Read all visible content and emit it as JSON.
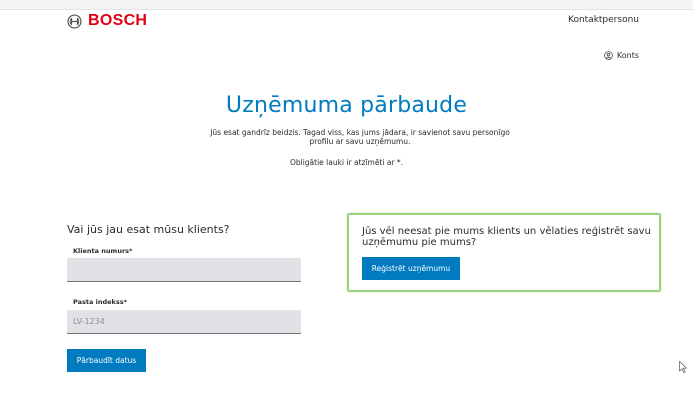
{
  "header": {
    "logo_text": "BOSCH",
    "brand_color": "#e20015",
    "contact_link": "Kontaktpersonu",
    "account_label": "Konts",
    "account_icon": "user-circle-icon",
    "logo_icon": "bosch-armature-icon"
  },
  "main": {
    "title": "Uzņēmuma pārbaude",
    "intro": "Jūs esat gandrīz beidzis. Tagad viss, kas jums jādara, ir savienot savu personīgo profilu ar savu uzņēmumu.",
    "required_note": "Obligātie lauki ir atzīmēti ar *.",
    "accent_color": "#007bc0"
  },
  "existing_customer": {
    "heading": "Vai jūs jau esat mūsu klients?",
    "customer_number_label": "Klienta numurs*",
    "customer_number_value": "",
    "postal_code_label": "Pasta indekss*",
    "postal_code_placeholder": "LV-1234",
    "check_button": "Pārbaudīt datus"
  },
  "new_customer": {
    "heading": "Jūs vēl neesat pie mums klients un vēlaties reģistrēt savu uzņēmumu pie mums?",
    "register_button": "Reģistrēt uzņēmumu",
    "highlight_color": "#9bd17f"
  }
}
